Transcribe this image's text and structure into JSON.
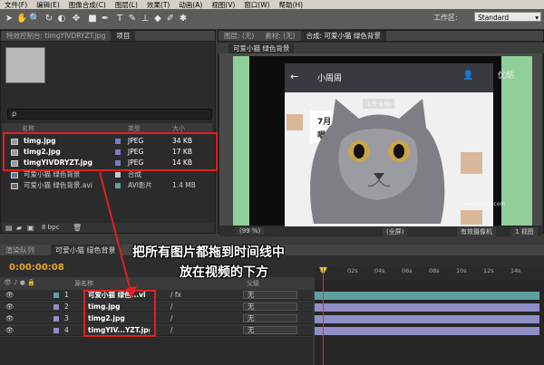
{
  "menu": [
    "文件(F)",
    "编辑(E)",
    "图像合成(C)",
    "图层(L)",
    "效果(T)",
    "动画(A)",
    "视图(V)",
    "窗口(W)",
    "帮助(H)"
  ],
  "workspace": {
    "label": "工作区:",
    "value": "Standard"
  },
  "project": {
    "tab_effects": "特效控制台: timgYIVDRYZT.jpg",
    "tab_project": "项目",
    "search_placeholder": "ρ",
    "col_name": "名称",
    "col_type": "类型",
    "col_size": "大小",
    "items": [
      {
        "name": "timg.jpg",
        "type": "JPEG",
        "size": "34 KB"
      },
      {
        "name": "timg2.jpg",
        "type": "JPEG",
        "size": "17 KB"
      },
      {
        "name": "timgYIVDRYZT.jpg",
        "type": "JPEG",
        "size": "14 KB"
      },
      {
        "name": "可爱小猫 绿色背景",
        "type": "合成",
        "size": ""
      },
      {
        "name": "可爱小猫 绿色背景.avi",
        "type": "AVI影片",
        "size": "1.4 MB"
      }
    ],
    "bpc": "8 bpc"
  },
  "viewer": {
    "tab_layer": "图层: (无)",
    "tab_footage": "素材: (无)",
    "tab_comp": "合成: 可爱小猫 绿色背景",
    "subtab": "可爱小猫 绿色背景",
    "phone_title": "小周周",
    "time_label": "上午 9:00",
    "msg1": "7月",
    "msg2": "唱会",
    "watermark": "优酷",
    "credit": "www.CGer.com",
    "zoom": "(99 %)",
    "res": "(全屏)",
    "camera": "有效摄像机",
    "view": "1 视图"
  },
  "timeline": {
    "tab_render": "渲染队列",
    "tab_comp": "可爱小猫 绿色背景",
    "timecode": "0:00:00:08",
    "col_name": "源名称",
    "col_parent": "父级",
    "ticks": [
      "0f",
      "02s",
      "04s",
      "06s",
      "08s",
      "10s",
      "12s",
      "14s"
    ],
    "layers": [
      {
        "num": "1",
        "name": "可爱小猫 绿色...vi",
        "parent": "无",
        "color": "#5fa0a0"
      },
      {
        "num": "2",
        "name": "timg.jpg",
        "parent": "无",
        "color": "#8f8fc8"
      },
      {
        "num": "3",
        "name": "timg2.jpg",
        "parent": "无",
        "color": "#8f8fc8"
      },
      {
        "num": "4",
        "name": "timgYIV...YZT.jpg",
        "parent": "无",
        "color": "#8f8fc8"
      }
    ]
  },
  "annotation": {
    "line1": "把所有图片都拖到时间线中",
    "line2": "放在视频的下方"
  }
}
